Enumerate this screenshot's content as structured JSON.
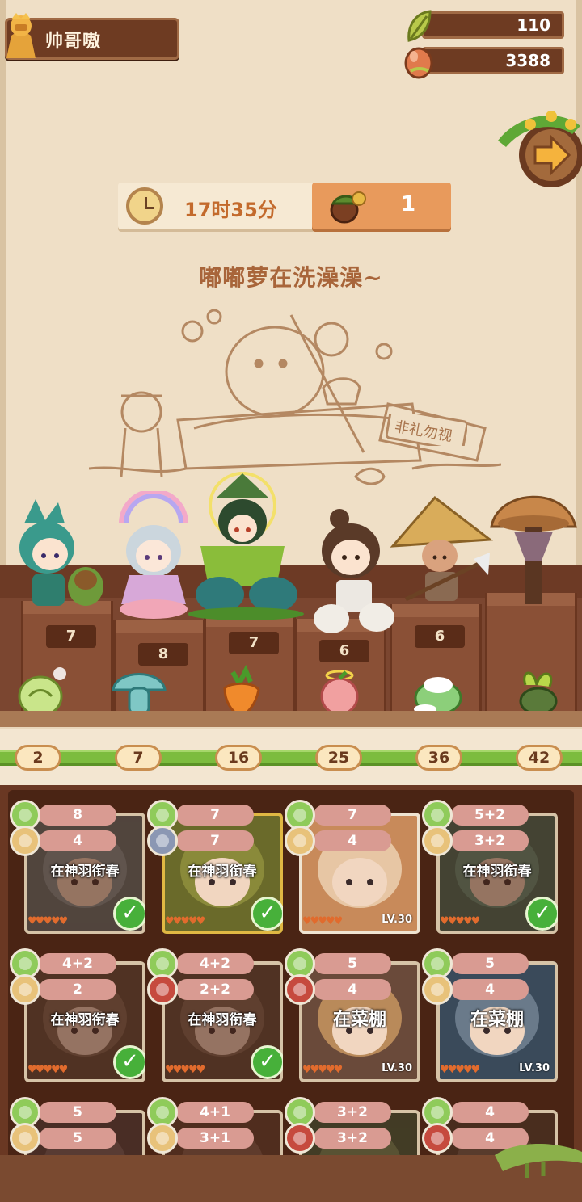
{
  "player": {
    "name": "帅哥嗷"
  },
  "resources": {
    "leaf": "110",
    "egg": "3388"
  },
  "timer": {
    "time": "17时35分",
    "count": "1"
  },
  "status": "嘟嘟萝在洗澡澡~",
  "sign": "非礼勿视",
  "pedestals": [
    "7",
    "8",
    "7",
    "6",
    "6"
  ],
  "milestones": [
    "2",
    "7",
    "16",
    "25",
    "36",
    "42"
  ],
  "progress": 1.0,
  "cards": [
    {
      "top": "8",
      "bottom": "4",
      "bottom_icon": "bread",
      "label": "在神羽衔春",
      "level": "LV",
      "done": true,
      "style": "dim"
    },
    {
      "top": "7",
      "bottom": "7",
      "bottom_icon": "fish",
      "label": "在神羽衔春",
      "level": "LV",
      "done": true,
      "style": "gold"
    },
    {
      "top": "7",
      "bottom": "4",
      "bottom_icon": "bread",
      "label": "",
      "level": "LV.30",
      "done": false,
      "style": "bright"
    },
    {
      "top": "5+2",
      "bottom": "3+2",
      "bottom_icon": "bread",
      "label": "在神羽衔春",
      "level": "",
      "done": true,
      "style": "dim"
    },
    {
      "top": "4+2",
      "bottom": "2",
      "bottom_icon": "bread",
      "label": "在神羽衔春",
      "level": "LV",
      "done": true,
      "style": "dim"
    },
    {
      "top": "4+2",
      "bottom": "2+2",
      "bottom_icon": "meat",
      "label": "在神羽衔春",
      "level": "LV",
      "done": true,
      "style": "dim"
    },
    {
      "top": "5",
      "bottom": "4",
      "bottom_icon": "meat",
      "label": "在菜棚",
      "level": "LV.30",
      "done": false,
      "style": "big"
    },
    {
      "top": "5",
      "bottom": "4",
      "bottom_icon": "bread",
      "label": "在菜棚",
      "level": "LV.30",
      "done": false,
      "style": "big"
    },
    {
      "top": "5",
      "bottom": "5",
      "bottom_icon": "bread",
      "label": "",
      "level": "",
      "done": false,
      "style": "dim"
    },
    {
      "top": "4+1",
      "bottom": "3+1",
      "bottom_icon": "bread",
      "label": "",
      "level": "",
      "done": false,
      "style": "dim"
    },
    {
      "top": "3+2",
      "bottom": "3+2",
      "bottom_icon": "meat",
      "label": "",
      "level": "",
      "done": false,
      "style": "dim"
    },
    {
      "top": "4",
      "bottom": "4",
      "bottom_icon": "meat",
      "label": "",
      "level": "",
      "done": false,
      "style": "dim"
    }
  ]
}
